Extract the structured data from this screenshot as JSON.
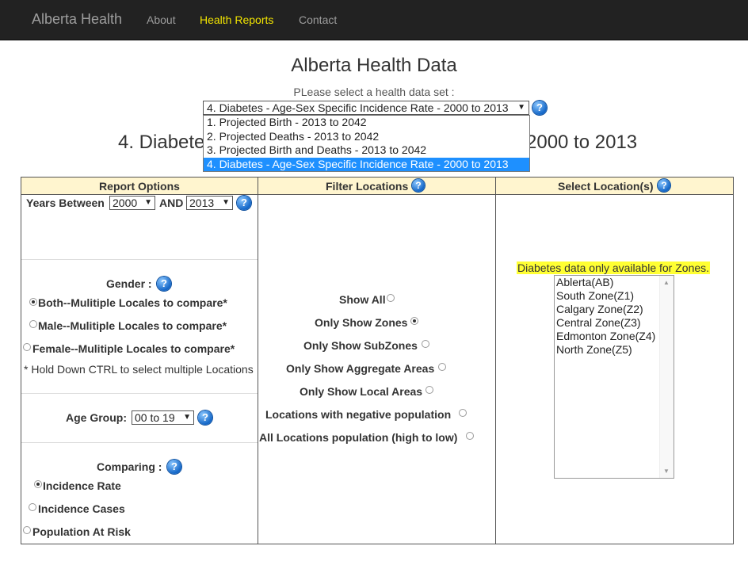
{
  "navbar": {
    "brand": "Alberta Health",
    "links": [
      {
        "label": "About"
      },
      {
        "label": "Health Reports"
      },
      {
        "label": "Contact"
      }
    ]
  },
  "page": {
    "title": "Alberta Health Data",
    "select_label": "PLease select a health data set :",
    "dataset_selected": "4. Diabetes - Age-Sex Specific Incidence Rate - 2000 to 2013",
    "dataset_options": [
      "1. Projected Birth - 2013 to 2042",
      "2. Projected Deaths - 2013 to 2042",
      "3. Projected Birth and Deaths - 2013 to 2042",
      "4. Diabetes - Age-Sex Specific Incidence Rate - 2000 to 2013"
    ],
    "heading_left": "4. Diabete",
    "heading_right": "2000 to 2013"
  },
  "columns": {
    "report_options": "Report Options",
    "filter_locations": "Filter Locations",
    "select_locations": "Select Location(s)"
  },
  "report_options": {
    "years_between": "Years Between",
    "year_from": "2000",
    "and_label": "AND",
    "year_to": "2013",
    "gender_label": "Gender :",
    "gender_options": [
      {
        "label": "Both--Mulitiple Locales to compare*",
        "checked": true
      },
      {
        "label": "Male--Mulitiple Locales to compare*",
        "checked": false
      },
      {
        "label": "Female--Mulitiple Locales to compare*",
        "checked": false
      }
    ],
    "ctrl_note": "* Hold Down CTRL to select multiple Locations",
    "age_group_label": "Age Group:",
    "age_group_value": "00 to 19",
    "comparing_label": "Comparing :",
    "comparing_options": [
      {
        "label": "Incidence Rate",
        "checked": true
      },
      {
        "label": "Incidence Cases",
        "checked": false
      },
      {
        "label": "Population At Risk",
        "checked": false
      }
    ]
  },
  "filter_locations": {
    "options": [
      {
        "label": "Show All",
        "checked": false
      },
      {
        "label": "Only Show Zones",
        "checked": true
      },
      {
        "label": "Only Show SubZones",
        "checked": false
      },
      {
        "label": "Only Show Aggregate Areas",
        "checked": false
      },
      {
        "label": "Only Show Local Areas",
        "checked": false
      },
      {
        "label": "Locations with negative population",
        "checked": false
      },
      {
        "label": "All Locations population (high to low)",
        "checked": false
      }
    ]
  },
  "select_locations": {
    "note": "Diabetes data only available for Zones.",
    "items": [
      "Ablerta(AB)",
      "South Zone(Z1)",
      "Calgary Zone(Z2)",
      "Central Zone(Z3)",
      "Edmonton Zone(Z4)",
      "North Zone(Z5)"
    ]
  },
  "icons": {
    "help": "?",
    "dropdown": "▼",
    "scroll_up": "▲",
    "scroll_down": "▼"
  },
  "colors": {
    "navbar_bg": "#222222",
    "active_link": "#f3e500",
    "header_bg": "#fff5cf",
    "selected_option": "#1e90ff",
    "note_highlight": "#ffff33",
    "help_icon": "#1467c8"
  }
}
